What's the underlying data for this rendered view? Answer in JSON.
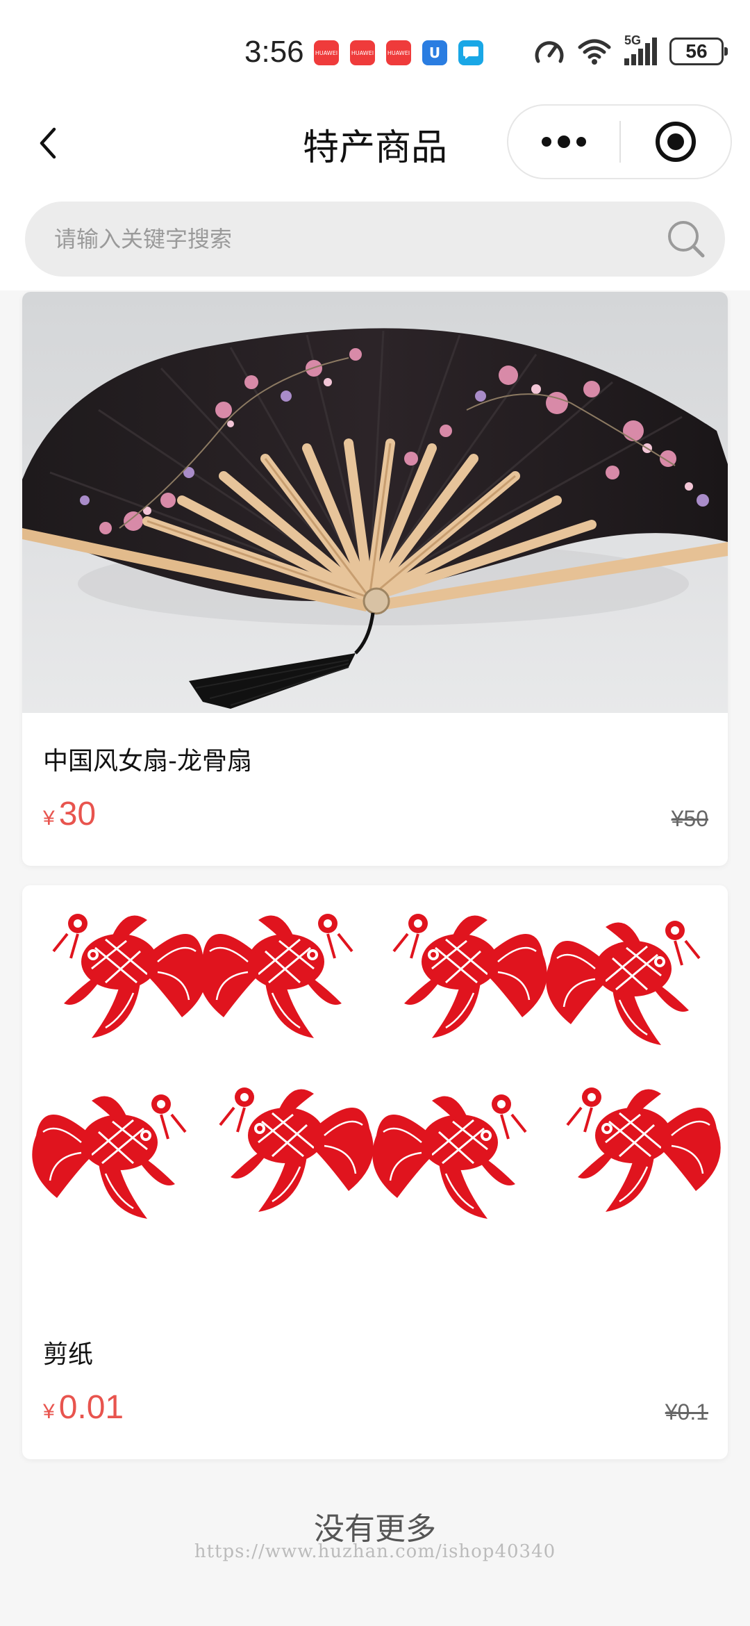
{
  "status_bar": {
    "time": "3:56",
    "notifications": [
      "huawei-mall-icon",
      "huawei-mall-icon",
      "huawei-mall-icon",
      "blue-app-icon",
      "message-app-icon"
    ],
    "notification_label": "HUAWEI",
    "network": "5G",
    "battery": "56"
  },
  "nav": {
    "title": "特产商品"
  },
  "search": {
    "placeholder": "请输入关键字搜索"
  },
  "products": [
    {
      "name": "中国风女扇-龙骨扇",
      "currency": "¥",
      "price": "30",
      "original_price": "¥50"
    },
    {
      "name": "剪纸",
      "currency": "¥",
      "price": "0.01",
      "original_price": "¥0.1"
    }
  ],
  "footer": {
    "no_more": "没有更多",
    "watermark": "https://www.huzhan.com/ishop40340"
  },
  "colors": {
    "accent_price": "#e8544e",
    "papercut_red": "#e0141e"
  }
}
